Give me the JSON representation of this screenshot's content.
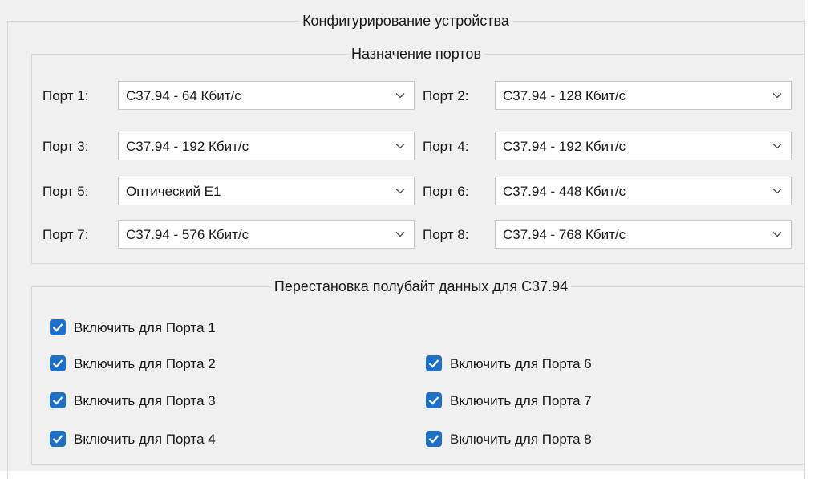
{
  "device_config": {
    "title": "Конфигурирование устройства",
    "port_assignment": {
      "title": "Назначение портов",
      "ports": [
        {
          "label": "Порт 1:",
          "value": "С37.94 - 64 Кбит/с"
        },
        {
          "label": "Порт 2:",
          "value": "С37.94 - 128 Кбит/с"
        },
        {
          "label": "Порт 3:",
          "value": "С37.94 - 192 Кбит/с"
        },
        {
          "label": "Порт 4:",
          "value": "С37.94 - 192 Кбит/с"
        },
        {
          "label": "Порт 5:",
          "value": "Оптический Е1"
        },
        {
          "label": "Порт 6:",
          "value": "С37.94 - 448 Кбит/с"
        },
        {
          "label": "Порт 7:",
          "value": "С37.94 - 576 Кбит/с"
        },
        {
          "label": "Порт 8:",
          "value": "С37.94 - 768 Кбит/с"
        }
      ]
    },
    "nibble_swap": {
      "title": "Перестановка полубайт данных для С37.94",
      "checkboxes": [
        {
          "label": "Включить для Порта 1",
          "checked": true
        },
        {
          "label": "Включить для Порта 2",
          "checked": true
        },
        {
          "label": "Включить для Порта 3",
          "checked": true
        },
        {
          "label": "Включить для Порта 4",
          "checked": true
        },
        {
          "label": "Включить для Порта 6",
          "checked": true
        },
        {
          "label": "Включить для Порта 7",
          "checked": true
        },
        {
          "label": "Включить для Порта 8",
          "checked": true
        }
      ]
    }
  },
  "colors": {
    "accent": "#1e6fc8",
    "background": "#f0f0f0",
    "border": "#d8d8d8"
  },
  "icons": {
    "dropdown": "chevron-down-icon",
    "checkbox": "checkmark-icon"
  }
}
